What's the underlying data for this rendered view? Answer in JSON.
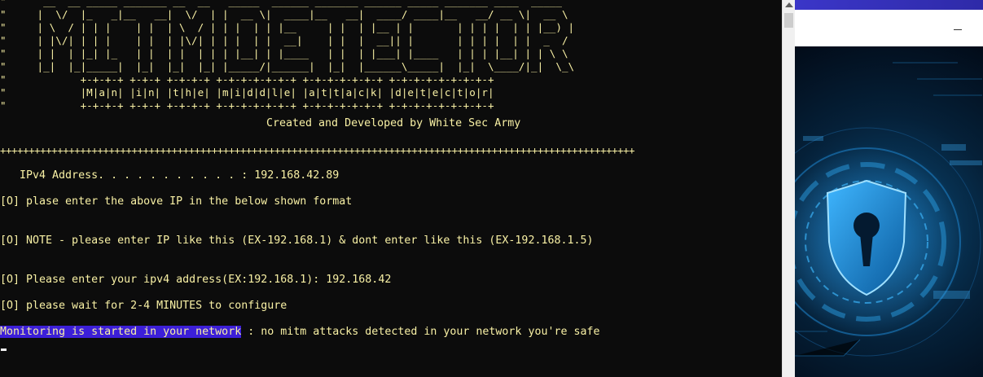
{
  "terminal": {
    "banner": [
      "\"      __  __ _____ _______ __  __   _____  ______ _______ ______ _____ _______ ____  _____  ",
      "\"     |  \\/  |_   _|__   __|  \\/  | |  __ \\|  ____|__   __|  ____/ ____|__   __/ __ \\|  __ \\ ",
      "\"     | \\  / | | |    | |  | \\  / | | |  | | |__     | |  | |__ | |       | | | |  | | |__) |",
      "\"     | |\\/| | | |    | |  | |\\/| | | |  | |  __|    | |  |  __|| |       | | | |  | |  _  / ",
      "\"     | |  | |_| |_   | |  | |  | | | |__| | |____   | |  | |___| |____   | | | |__| | | \\ \\ ",
      "\"     |_|  |_|_____|  |_|  |_|  |_| |_____/|______|  |_|  |______\\_____|  |_|  \\____/|_|  \\_\\",
      "\"            |M|a|n| |i|n| |t|h|e| |m|i|d|d|l|e| |a|t|t|a|c|k| |d|e|t|e|c|t|o|r|",
      "\"            +-+-+-+ +-+-+ +-+-+-+ +-+-+-+-+-+-+ +-+-+-+-+-+-+ +-+-+-+-+-+-+-+-+"
    ],
    "banner_top_border": "            +-+-+-+ +-+-+ +-+-+-+ +-+-+-+-+-+-+ +-+-+-+-+-+-+ +-+-+-+-+-+-+-+-+",
    "credits": "Created and Developed by White Sec Army",
    "separator": "+++++++++++++++++++++++++++++++++++++++++++++++++++++++++++++++++++++++++++++++++++++++++++++++++++++++++++++++",
    "ipv4_line": "   IPv4 Address. . . . . . . . . . . : 192.168.42.89",
    "format_prompt": "[O] plase enter the above IP in the below shown format",
    "note": "[O] NOTE - please enter IP like this (EX-192.168.1) & dont enter like this (EX-192.168.1.5)",
    "input_prompt": "[O] Please enter your ipv4 address(EX:192.168.1): 192.168.42",
    "wait_message": "[O] please wait for 2-4 MINUTES to configure",
    "monitor_highlight": "Monitoring is started in your network",
    "monitor_rest": " : no mitm attacks detected in your network you're safe"
  },
  "colors": {
    "terminal_bg": "#0c0c0c",
    "text_yellow": "#f9f1a5",
    "highlight_bg": "#3c1fd8",
    "accent_band": "#3b36c8"
  },
  "icons": {
    "scroll_up": "triangle-up",
    "window_minimize": "minimize",
    "hero": "shield-keyhole"
  }
}
